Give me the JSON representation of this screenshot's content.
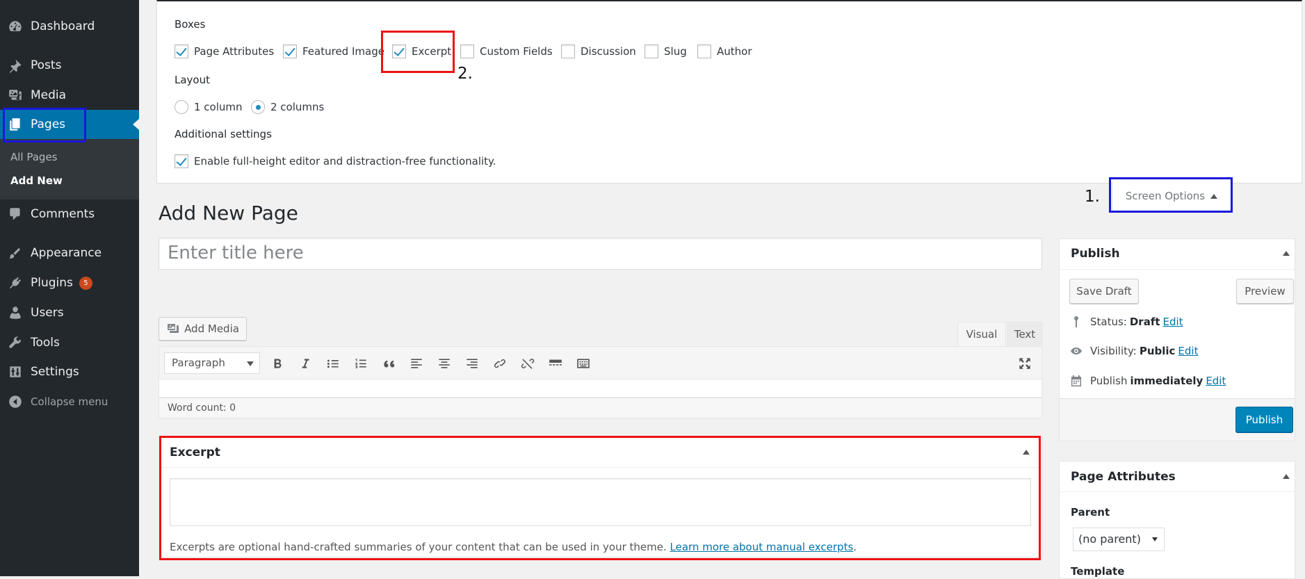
{
  "sidebar": {
    "items": [
      {
        "label": "Dashboard",
        "icon": "dashboard-icon"
      },
      {
        "label": "Posts",
        "icon": "pin-icon"
      },
      {
        "label": "Media",
        "icon": "media-icon"
      },
      {
        "label": "Pages",
        "icon": "pages-icon"
      },
      {
        "label": "Comments",
        "icon": "comment-icon"
      },
      {
        "label": "Appearance",
        "icon": "brush-icon"
      },
      {
        "label": "Plugins",
        "icon": "plug-icon"
      },
      {
        "label": "Users",
        "icon": "user-icon"
      },
      {
        "label": "Tools",
        "icon": "wrench-icon"
      },
      {
        "label": "Settings",
        "icon": "settings-icon"
      }
    ],
    "plugins_badge": "5",
    "submenu": {
      "all_pages": "All Pages",
      "add_new": "Add New"
    },
    "collapse": "Collapse menu"
  },
  "screen_options": {
    "boxes_heading": "Boxes",
    "boxes": [
      {
        "label": "Page Attributes",
        "checked": true
      },
      {
        "label": "Featured Image",
        "checked": true
      },
      {
        "label": "Excerpt",
        "checked": true
      },
      {
        "label": "Custom Fields",
        "checked": false
      },
      {
        "label": "Discussion",
        "checked": false
      },
      {
        "label": "Slug",
        "checked": false
      },
      {
        "label": "Author",
        "checked": false
      }
    ],
    "layout_heading": "Layout",
    "layout_options": [
      "1 column",
      "2 columns"
    ],
    "layout_selected": "2 columns",
    "additional_heading": "Additional settings",
    "additional_label": "Enable full-height editor and distraction-free functionality.",
    "button_label": "Screen Options"
  },
  "annotations": {
    "one": "1.",
    "two": "2."
  },
  "page": {
    "title": "Add New Page",
    "title_placeholder": "Enter title here"
  },
  "editor": {
    "add_media": "Add Media",
    "tab_visual": "Visual",
    "tab_text": "Text",
    "format_select": "Paragraph",
    "word_count": "Word count: 0"
  },
  "excerpt": {
    "heading": "Excerpt",
    "help_text": "Excerpts are optional hand-crafted summaries of your content that can be used in your theme. ",
    "help_link": "Learn more about manual excerpts",
    "help_end": "."
  },
  "publish": {
    "heading": "Publish",
    "save_draft": "Save Draft",
    "preview": "Preview",
    "status_label": "Status:",
    "status_value": "Draft",
    "visibility_label": "Visibility:",
    "visibility_value": "Public",
    "publish_label": "Publish",
    "publish_value": "immediately",
    "edit": "Edit",
    "publish_button": "Publish"
  },
  "page_attributes": {
    "heading": "Page Attributes",
    "parent_label": "Parent",
    "parent_value": "(no parent)",
    "template_label": "Template"
  },
  "colors": {
    "accent": "#0073aa",
    "sidebar": "#23282d",
    "highlight_red": "#e11111",
    "highlight_blue": "#1919d9"
  }
}
